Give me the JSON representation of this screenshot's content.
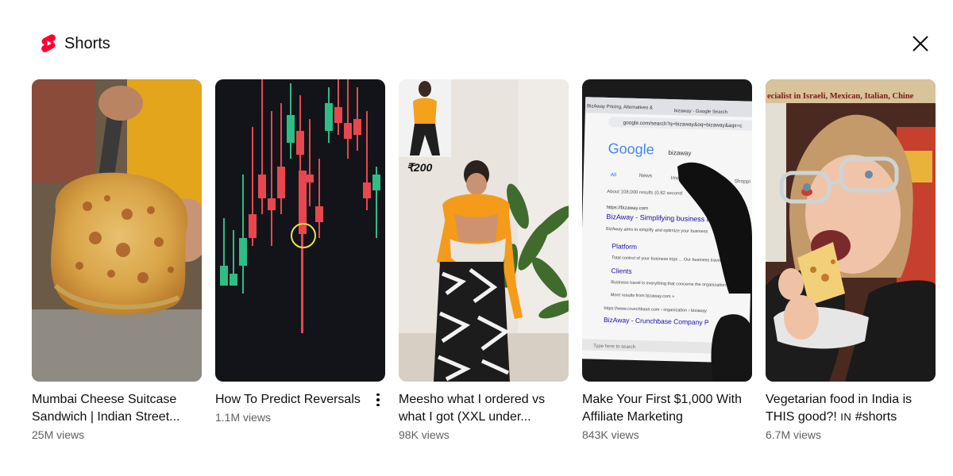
{
  "header": {
    "title": "Shorts",
    "logo_icon": "youtube-shorts-logo",
    "close_icon": "close-icon"
  },
  "colors": {
    "brand_red": "#ff0033",
    "text_primary": "#0f0f0f",
    "text_secondary": "#606060"
  },
  "shorts": [
    {
      "title": "Mumbai Cheese Suitcase Sandwich | Indian Street...",
      "views": "25M views",
      "has_menu": false,
      "thumbnail": "cheese-sandwich"
    },
    {
      "title": "How To Predict Reversals",
      "views": "1.1M views",
      "has_menu": true,
      "thumbnail": "candlestick-chart"
    },
    {
      "title": "Meesho what I ordered vs what I got (XXL under...",
      "views": "98K views",
      "has_menu": false,
      "thumbnail": "fashion-haul",
      "overlay_price": "₹200"
    },
    {
      "title": "Make Your First $1,000 With Affiliate Marketing",
      "views": "843K views",
      "has_menu": false,
      "thumbnail": "google-search-screen",
      "screen_text": {
        "tab1": "BizAway Pricing, Alternatives & ",
        "tab2": "bizaway - Google Search",
        "url": "google.com/search?q=bizaway&oq=bizaway&aqs=c",
        "google": "Google",
        "query": "bizaway",
        "tab_all": "All",
        "tab_news": "News",
        "tab_images": "Imag",
        "tab_shopping": "Shoppi",
        "results": "About 108,000 results (0.82 second",
        "result_url": "https://bizaway.com",
        "result_title": "BizAway - Simplifying business tra",
        "result_snippet": "BizAway aims to simplify and optimize your business",
        "sub1": "Platform",
        "sub1_desc": "Total control of your business trips ... Our business travel",
        "sub2": "Clients",
        "sub2_desc": "Business travel is everything that concerns the organization of a",
        "more": "More results from bizaway.com »",
        "result2_url": "https://www.crunchbase.com › organization › bizaway",
        "result2_title": "BizAway - Crunchbase Company P",
        "type_here": "Type here to search"
      }
    },
    {
      "title_main": "Vegetarian food in India is THIS good?! ",
      "title_in": "IN",
      "title_tag": " #shorts",
      "views": "6.7M views",
      "has_menu": false,
      "thumbnail": "street-food-eating",
      "sign_text": "ecialist in Israeli, Mexican, Italian, Chine"
    }
  ]
}
